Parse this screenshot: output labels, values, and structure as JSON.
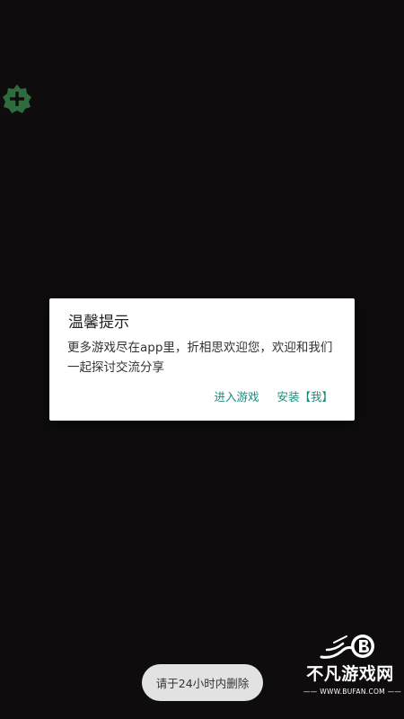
{
  "float_button": {
    "icon": "plus-gear-icon",
    "color": "#2e6b3e"
  },
  "dialog": {
    "title": "温馨提示",
    "message": "更多游戏尽在app里，折相思欢迎您，欢迎和我们一起探讨交流分享",
    "buttons": {
      "enter_game": "进入游戏",
      "install": "安装【我】"
    },
    "accent_color": "#1b8a7a"
  },
  "toast": {
    "text": "请于24小时内删除"
  },
  "watermark": {
    "name": "不凡游戏网",
    "url": "—— WWW.BUFAN.COM ——"
  }
}
